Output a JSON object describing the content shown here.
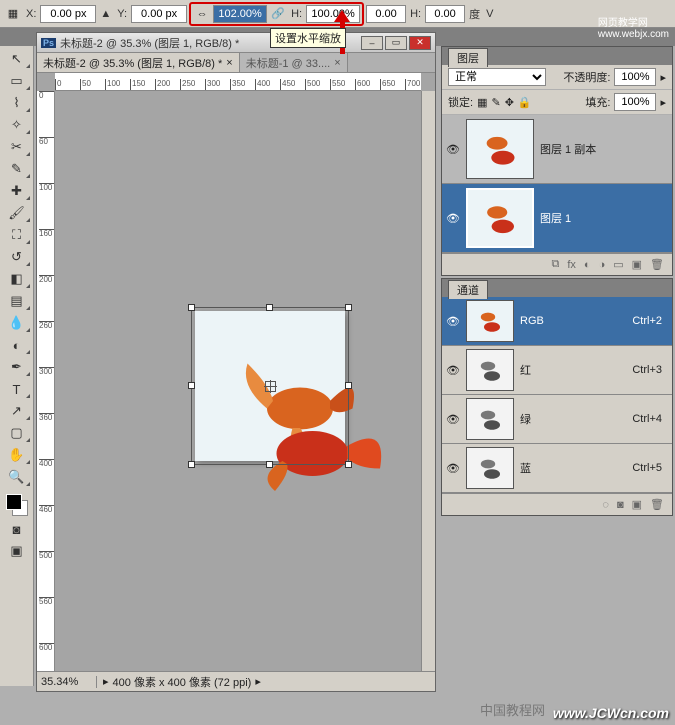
{
  "options_bar": {
    "x_label": "X:",
    "x_value": "0.00 px",
    "y_label": "Y:",
    "y_value": "0.00 px",
    "w_pct_value": "102.00%",
    "link_icon": "link-icon",
    "h_label": "H:",
    "h_pct_value": "100.00%",
    "angle_value": "0.00",
    "hh_label": "H:",
    "hh_value": "0.00",
    "deg_label": "度",
    "v_label": "V",
    "triangle_icon": "▲"
  },
  "watermarks": {
    "top": "网页教学网",
    "top_url": "www.webjx.com",
    "bottom_cn": "中国教程网",
    "bottom_url": "www.JCWcn.com"
  },
  "tooltip": "设置水平缩放",
  "doc_window": {
    "title": "未标题-2 @ 35.3% (图层 1, RGB/8) *",
    "tabs": [
      {
        "label": "未标题-2 @ 35.3% (图层 1, RGB/8) *"
      },
      {
        "label": "未标题-1 @ 33...."
      }
    ],
    "ruler_h": [
      "0",
      "50",
      "100",
      "150",
      "200",
      "250",
      "300",
      "350",
      "400",
      "450",
      "500",
      "550",
      "600",
      "650",
      "700"
    ],
    "ruler_v": [
      "0",
      "60",
      "100",
      "160",
      "200",
      "260",
      "300",
      "360",
      "400",
      "460",
      "500",
      "560",
      "600"
    ],
    "status_zoom": "35.34%",
    "status_info": "400 像素 x 400 像素 (72 ppi)"
  },
  "panels": {
    "layers": {
      "tab": "图层",
      "blend_mode": "正常",
      "opacity_label": "不透明度:",
      "opacity_value": "100%",
      "lock_label": "锁定:",
      "fill_label": "填充:",
      "fill_value": "100%",
      "items": [
        {
          "name": "图层 1 副本",
          "visible": true,
          "selected": false
        },
        {
          "name": "图层 1",
          "visible": true,
          "selected": true
        }
      ]
    },
    "channels": {
      "tab": "通道",
      "items": [
        {
          "name": "RGB",
          "shortcut": "Ctrl+2",
          "selected": true
        },
        {
          "name": "红",
          "shortcut": "Ctrl+3",
          "selected": false
        },
        {
          "name": "绿",
          "shortcut": "Ctrl+4",
          "selected": false
        },
        {
          "name": "蓝",
          "shortcut": "Ctrl+5",
          "selected": false
        }
      ]
    }
  },
  "tools": [
    "move",
    "marquee",
    "lasso",
    "wand",
    "crop",
    "eyedrop",
    "heal",
    "brush",
    "stamp",
    "history",
    "eraser",
    "gradient",
    "blur",
    "dodge",
    "pen",
    "type",
    "path",
    "shape",
    "hand",
    "zoom"
  ]
}
